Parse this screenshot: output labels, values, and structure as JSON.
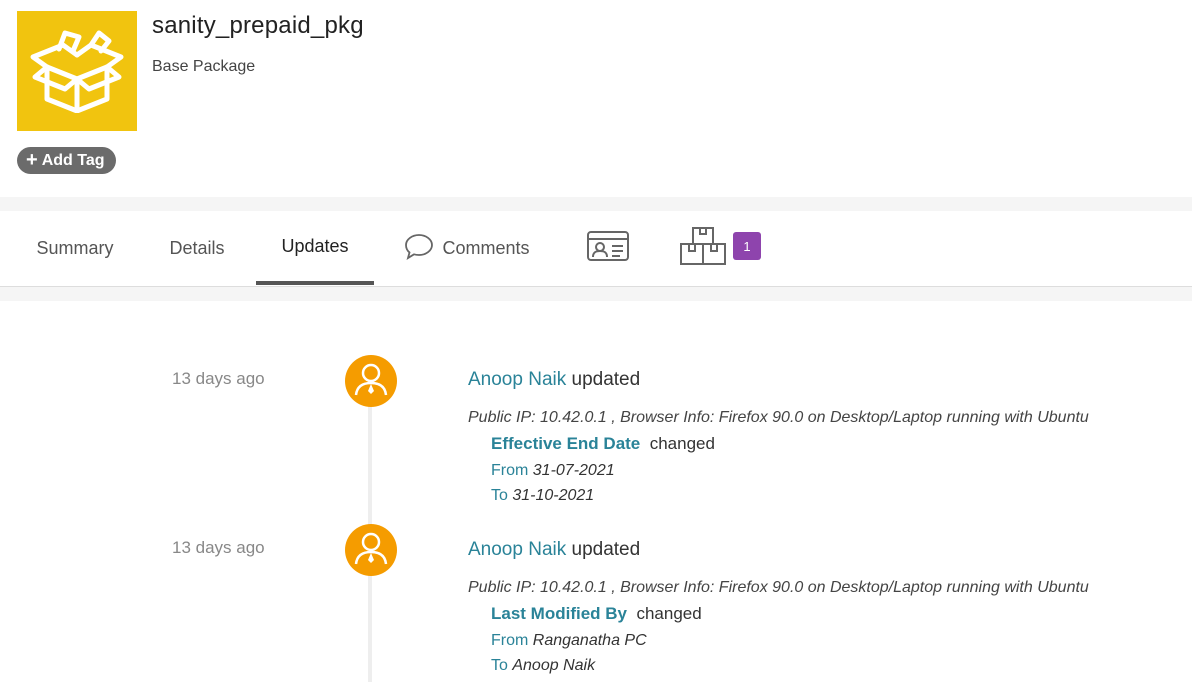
{
  "header": {
    "title": "sanity_prepaid_pkg",
    "subtitle": "Base Package",
    "add_tag_label": "Add Tag",
    "icon": "open-box-icon",
    "icon_bg": "#f1c40f"
  },
  "tabs": [
    {
      "label": "Summary"
    },
    {
      "label": "Details"
    },
    {
      "label": "Updates",
      "active": true
    },
    {
      "label": "Comments",
      "icon": "speech-bubble-icon"
    },
    {
      "label": "",
      "icon": "contact-card-icon"
    },
    {
      "label": "",
      "icon": "stacked-boxes-icon",
      "badge": "1"
    }
  ],
  "colors": {
    "accent": "#2a8398",
    "avatar": "#f59c00",
    "badge": "#8e44ad",
    "tag": "#6b6b6b"
  },
  "updates": [
    {
      "time": "13 days ago",
      "user": "Anoop Naik",
      "action": "updated",
      "meta": "Public IP: 10.42.0.1 , Browser Info: Firefox 90.0 on Desktop/Laptop running with Ubuntu",
      "field": "Effective End Date",
      "changed": "changed",
      "from_label": "From",
      "from": "31-07-2021",
      "to_label": "To",
      "to": "31-10-2021"
    },
    {
      "time": "13 days ago",
      "user": "Anoop Naik",
      "action": "updated",
      "meta": "Public IP: 10.42.0.1 , Browser Info: Firefox 90.0 on Desktop/Laptop running with Ubuntu",
      "field": "Last Modified By",
      "changed": "changed",
      "from_label": "From",
      "from": "Ranganatha PC",
      "to_label": "To",
      "to": "Anoop Naik"
    }
  ]
}
